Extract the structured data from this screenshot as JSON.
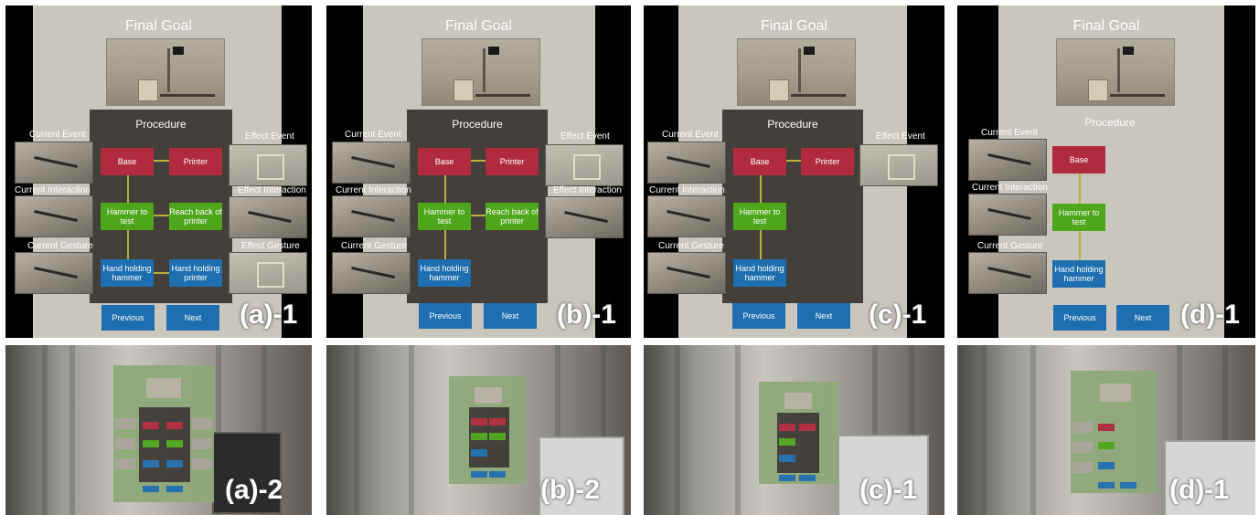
{
  "panels": [
    {
      "final_goal": "Final Goal",
      "procedure": "Procedure",
      "left_labels": [
        "Current Event",
        "Current Interaction",
        "Current Gesture"
      ],
      "right_labels": [
        "Effect Event",
        "Effect Interaction",
        "Effect Gesture"
      ],
      "nodes": {
        "base": "Base",
        "printer": "Printer",
        "hammer": "Hammer to test",
        "reach": "Reach back of printer",
        "hand_hammer": "Hand holding hammer",
        "hand_printer": "Hand holding printer"
      },
      "buttons": {
        "previous": "Previous",
        "next": "Next"
      },
      "top_label": "(a)-1",
      "bottom_label": "(a)-2"
    },
    {
      "final_goal": "Final Goal",
      "procedure": "Procedure",
      "left_labels": [
        "Current Event",
        "Current Interaction",
        "Current Gesture"
      ],
      "right_labels": [
        "Effect Event",
        "Effect Interaction"
      ],
      "nodes": {
        "base": "Base",
        "printer": "Printer",
        "hammer": "Hammer to test",
        "reach": "Reach back of printer",
        "hand_hammer": "Hand holding hammer"
      },
      "buttons": {
        "previous": "Previous",
        "next": "Next"
      },
      "top_label": "(b)-1",
      "bottom_label": "(b)-2"
    },
    {
      "final_goal": "Final Goal",
      "procedure": "Procedure",
      "left_labels": [
        "Current Event",
        "Current Interaction",
        "Current Gesture"
      ],
      "right_labels": [
        "Effect Event"
      ],
      "nodes": {
        "base": "Base",
        "printer": "Printer",
        "hammer": "Hammer to test",
        "hand_hammer": "Hand holding hammer"
      },
      "buttons": {
        "previous": "Previous",
        "next": "Next"
      },
      "top_label": "(c)-1",
      "bottom_label": "(c)-1"
    },
    {
      "final_goal": "Final Goal",
      "procedure": "Procedure",
      "left_labels": [
        "Current Event",
        "Current Interaction",
        "Current Gesture"
      ],
      "right_labels": [],
      "nodes": {
        "base": "Base",
        "hammer": "Hammer to test",
        "hand_hammer": "Hand holding hammer"
      },
      "buttons": {
        "previous": "Previous",
        "next": "Next"
      },
      "top_label": "(d)-1",
      "bottom_label": "(d)-1"
    }
  ],
  "colors": {
    "event_node": "#b02b3d",
    "interaction_node": "#4ea61b",
    "gesture_node": "#1f6fb0",
    "connector": "#b8b23c",
    "procedure_bg": "#433f3b"
  }
}
